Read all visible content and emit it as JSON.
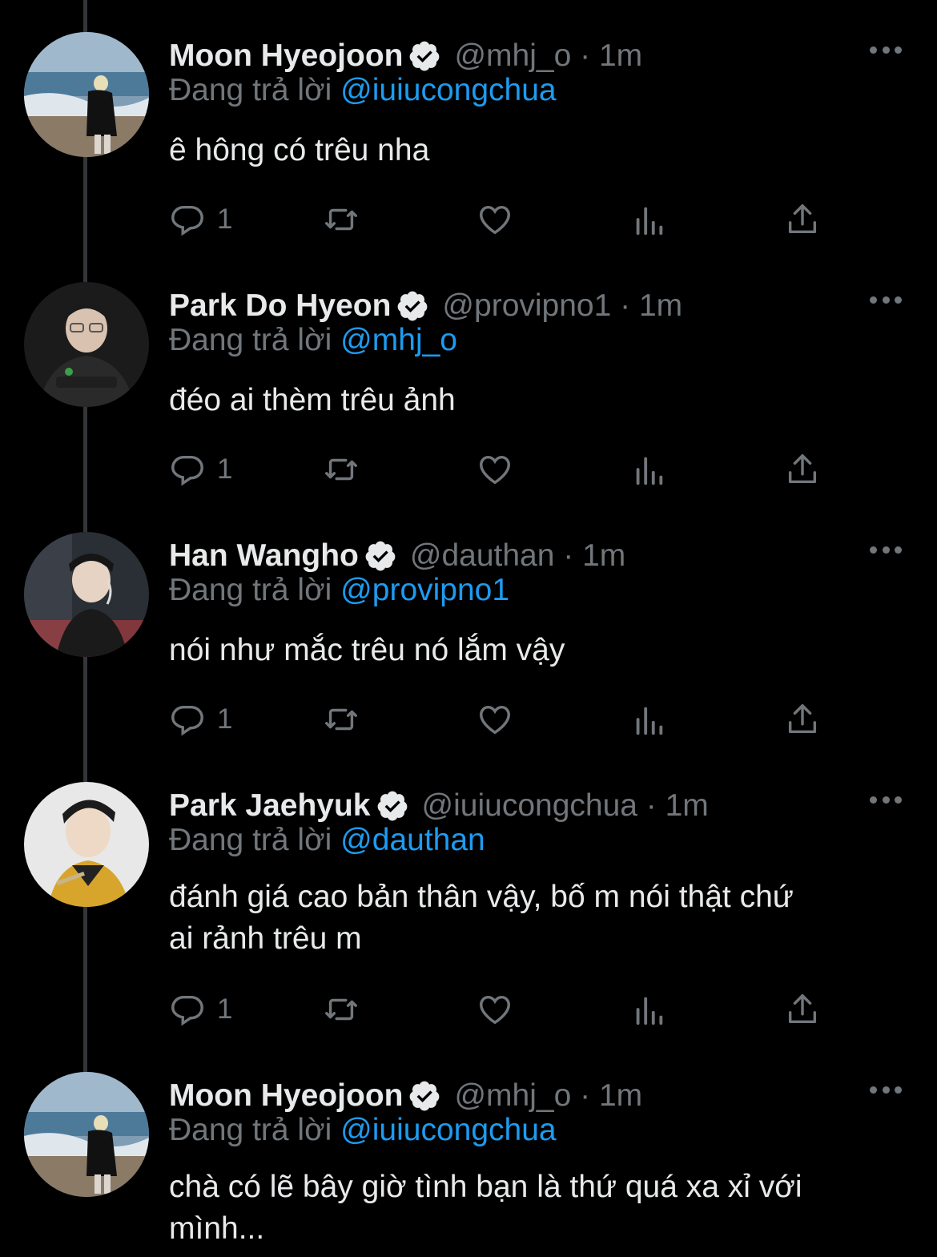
{
  "reply_prefix": "Đang trả lời",
  "tweets": [
    {
      "name": "Moon Hyeojoon",
      "handle": "@mhj_o · 1m",
      "reply_to": "@iuiucongchua",
      "text": "ê hông có trêu nha",
      "reply_count": "1",
      "avatar": "beach-photo"
    },
    {
      "name": "Park Do Hyeon",
      "handle": "@provipno1 · 1m",
      "reply_to": "@mhj_o",
      "text": "đéo ai thèm trêu ảnh",
      "reply_count": "1",
      "avatar": "dark-jacket-photo"
    },
    {
      "name": "Han Wangho",
      "handle": "@dauthan · 1m",
      "reply_to": "@provipno1",
      "text": "nói như mắc trêu nó lắm vậy",
      "reply_count": "1",
      "avatar": "headset-photo"
    },
    {
      "name": "Park Jaehyuk",
      "handle": "@iuiucongchua · 1m",
      "reply_to": "@dauthan",
      "text_line1": "đánh giá cao bản thân vậy, bố m nói thật chứ",
      "text_line2": "ai rảnh trêu m",
      "reply_count": "1",
      "avatar": "yellow-jersey-photo"
    },
    {
      "name": "Moon Hyeojoon",
      "handle": "@mhj_o · 1m",
      "reply_to": "@iuiucongchua",
      "text_line1": "chà có lẽ bây giờ tình bạn là thứ quá xa xỉ với",
      "text_line2": "mình...",
      "avatar": "beach-photo"
    }
  ],
  "colors": {
    "background": "#000000",
    "primary_text": "#e7e9ea",
    "secondary_text": "#71767b",
    "mention": "#1d9bf0",
    "thread_line": "#333639"
  },
  "icons": [
    "verified-badge-icon",
    "reply-icon",
    "retweet-icon",
    "like-icon",
    "views-icon",
    "share-icon",
    "more-icon"
  ]
}
